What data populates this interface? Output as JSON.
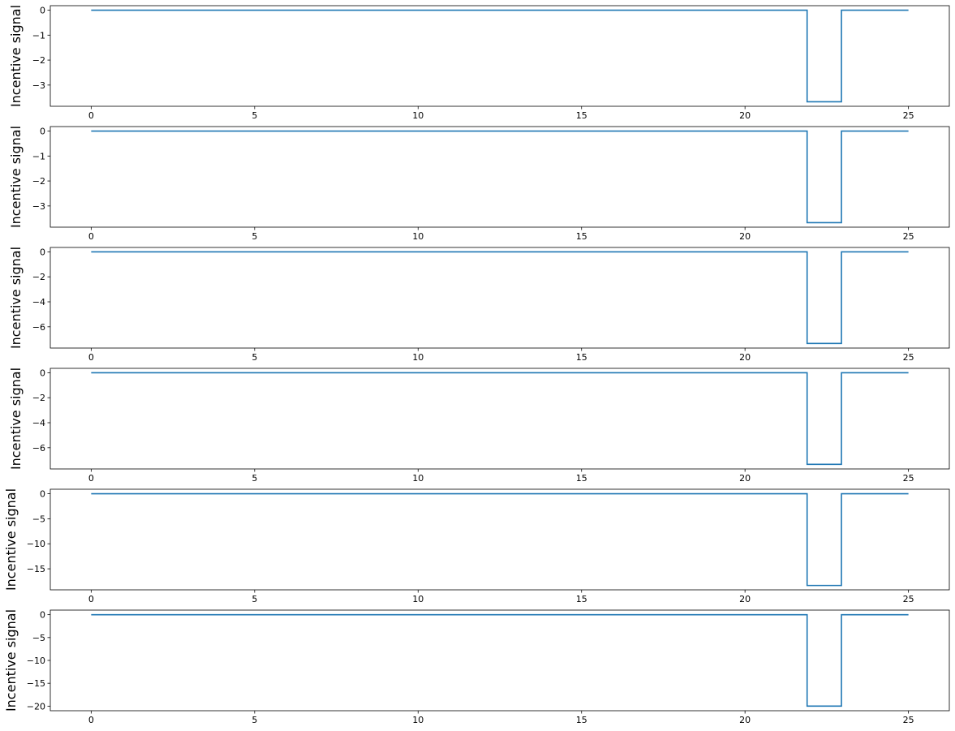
{
  "figure": {
    "background": "#ffffff",
    "line_color": "#1f77b4"
  },
  "chart_data": [
    {
      "type": "line",
      "step": true,
      "ylabel": "Incentive signal",
      "xlim": [
        -1.25,
        26.25
      ],
      "ylim": [
        -3.85,
        0.18
      ],
      "xticks": [
        0,
        5,
        10,
        15,
        20,
        25
      ],
      "yticks": [
        0,
        -1,
        -2,
        -3
      ],
      "series": [
        {
          "x": [
            0,
            21.9,
            21.9,
            22.95,
            22.95,
            25
          ],
          "y": [
            0,
            0,
            -3.67,
            -3.67,
            0,
            0
          ]
        }
      ]
    },
    {
      "type": "line",
      "step": true,
      "ylabel": "Incentive signal",
      "xlim": [
        -1.25,
        26.25
      ],
      "ylim": [
        -3.85,
        0.18
      ],
      "xticks": [
        0,
        5,
        10,
        15,
        20,
        25
      ],
      "yticks": [
        0,
        -1,
        -2,
        -3
      ],
      "series": [
        {
          "x": [
            0,
            21.9,
            21.9,
            22.95,
            22.95,
            25
          ],
          "y": [
            0,
            0,
            -3.67,
            -3.67,
            0,
            0
          ]
        }
      ]
    },
    {
      "type": "line",
      "step": true,
      "ylabel": "Incentive signal",
      "xlim": [
        -1.25,
        26.25
      ],
      "ylim": [
        -7.7,
        0.35
      ],
      "xticks": [
        0,
        5,
        10,
        15,
        20,
        25
      ],
      "yticks": [
        0,
        -2,
        -4,
        -6
      ],
      "series": [
        {
          "x": [
            0,
            21.9,
            21.9,
            22.95,
            22.95,
            25
          ],
          "y": [
            0,
            0,
            -7.33,
            -7.33,
            0,
            0
          ]
        }
      ]
    },
    {
      "type": "line",
      "step": true,
      "ylabel": "Incentive signal",
      "xlim": [
        -1.25,
        26.25
      ],
      "ylim": [
        -7.7,
        0.35
      ],
      "xticks": [
        0,
        5,
        10,
        15,
        20,
        25
      ],
      "yticks": [
        0,
        -2,
        -4,
        -6
      ],
      "series": [
        {
          "x": [
            0,
            21.9,
            21.9,
            22.95,
            22.95,
            25
          ],
          "y": [
            0,
            0,
            -7.33,
            -7.33,
            0,
            0
          ]
        }
      ]
    },
    {
      "type": "line",
      "step": true,
      "ylabel": "Incentive signal",
      "xlim": [
        -1.25,
        26.25
      ],
      "ylim": [
        -19.2,
        0.9
      ],
      "xticks": [
        0,
        5,
        10,
        15,
        20,
        25
      ],
      "yticks": [
        0,
        -5,
        -10,
        -15
      ],
      "series": [
        {
          "x": [
            0,
            21.9,
            21.9,
            22.95,
            22.95,
            25
          ],
          "y": [
            0,
            0,
            -18.33,
            -18.33,
            0,
            0
          ]
        }
      ]
    },
    {
      "type": "line",
      "step": true,
      "ylabel": "Incentive signal",
      "xlim": [
        -1.25,
        26.25
      ],
      "ylim": [
        -21.0,
        1.0
      ],
      "xticks": [
        0,
        5,
        10,
        15,
        20,
        25
      ],
      "yticks": [
        0,
        -5,
        -10,
        -15,
        -20
      ],
      "series": [
        {
          "x": [
            0,
            21.9,
            21.9,
            22.95,
            22.95,
            25
          ],
          "y": [
            0,
            0,
            -20.0,
            -20.0,
            0,
            0
          ]
        }
      ]
    }
  ]
}
